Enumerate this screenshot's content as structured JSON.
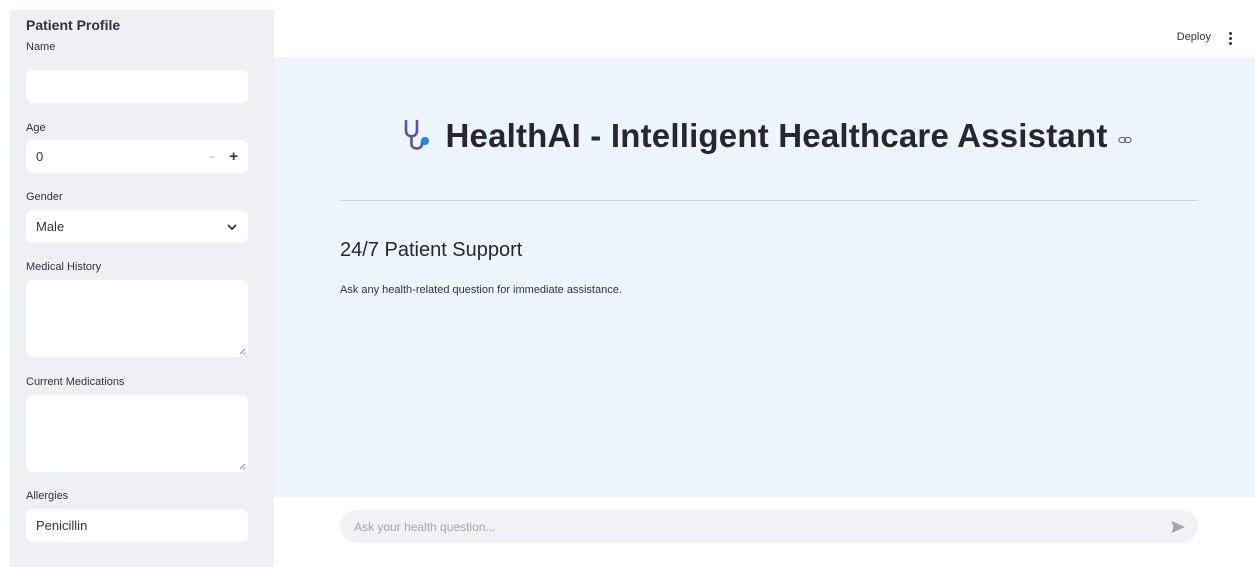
{
  "sidebar": {
    "title": "Patient Profile",
    "name": {
      "label": "Name",
      "value": ""
    },
    "age": {
      "label": "Age",
      "value": "0",
      "minus": "−",
      "plus": "+"
    },
    "gender": {
      "label": "Gender",
      "value": "Male"
    },
    "medical_history": {
      "label": "Medical History",
      "value": ""
    },
    "current_medications": {
      "label": "Current Medications",
      "value": ""
    },
    "allergies": {
      "label": "Allergies",
      "value": "Penicillin"
    }
  },
  "header": {
    "deploy_label": "Deploy",
    "menu_icon": "kebab-menu-icon"
  },
  "main": {
    "title": "HealthAI - Intelligent Healthcare Assistant",
    "title_icon": "stethoscope-icon",
    "section_title": "24/7 Patient Support",
    "section_description": "Ask any health-related question for immediate assistance."
  },
  "chat": {
    "placeholder": "Ask your health question...",
    "send_icon": "send-icon"
  },
  "colors": {
    "sidebar_bg": "#eef0f4",
    "main_bg": "#eef5fd",
    "stethoscope_stroke": "#5b4fa0",
    "stethoscope_accent": "#1e88e5"
  }
}
